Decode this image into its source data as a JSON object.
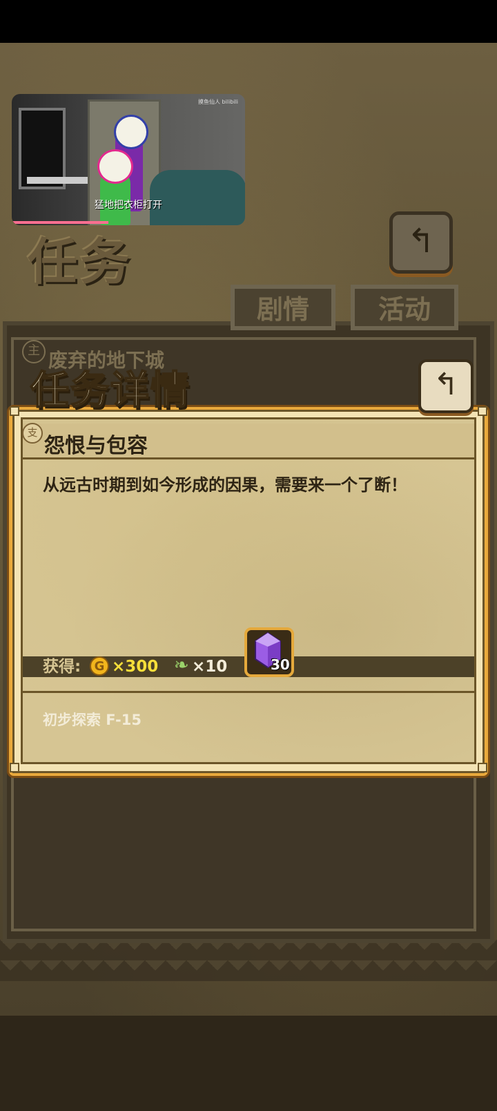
{
  "background": {
    "screen_title": "任务",
    "tabs": [
      {
        "label": "剧情"
      },
      {
        "label": "活动"
      }
    ],
    "quest_badge": "主",
    "quest_name": "废弃的地下城"
  },
  "video_overlay": {
    "subtitle": "猛地把衣柜打开",
    "watermark": "摸鱼仙人 bilibili"
  },
  "detail": {
    "title": "任务详情",
    "quest_badge": "支",
    "quest_name": "怨恨与包容",
    "description": "从远古时期到如今形成的因果，需要来一个了断！",
    "reward_label": "获得:",
    "rewards": [
      {
        "icon": "gold-coin-icon",
        "symbol": "G",
        "amount": "×300"
      },
      {
        "icon": "feather-icon",
        "amount": "×10"
      },
      {
        "icon": "purple-gem-icon",
        "amount": "30"
      }
    ],
    "progress": "初步探索 F-15"
  },
  "colors": {
    "panel_orange": "#e9a93c",
    "paper": "#d6c593",
    "coin": "#f2b51c",
    "gem": "#9b5de5"
  }
}
